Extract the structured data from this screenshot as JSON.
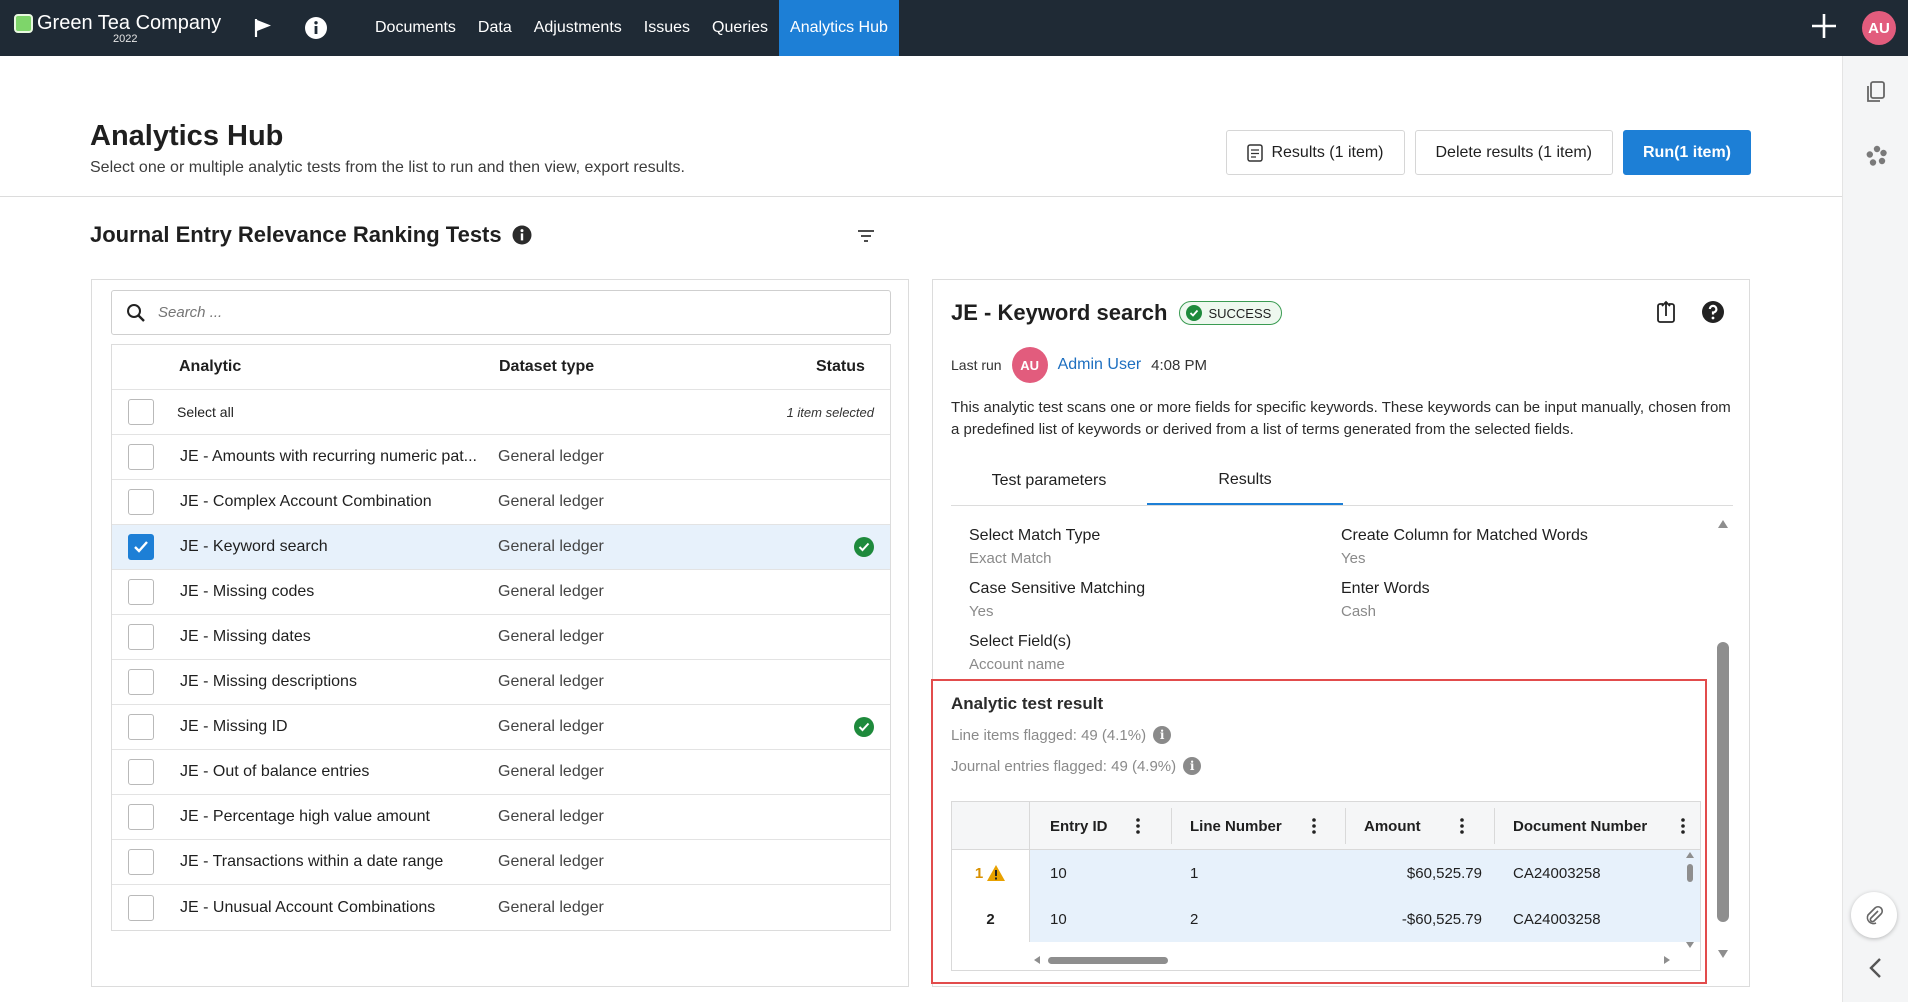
{
  "nav": {
    "brand": "Green Tea Company",
    "year": "2022",
    "links": [
      "Documents",
      "Data",
      "Adjustments",
      "Issues",
      "Queries",
      "Analytics Hub"
    ],
    "active_index": 5,
    "avatar": "AU"
  },
  "header": {
    "title": "Analytics Hub",
    "subtitle": "Select one or multiple analytic tests from the list to run and then view, export results.",
    "results_btn": "Results (1 item)",
    "delete_btn": "Delete results (1 item)",
    "run_btn": "Run(1 item)"
  },
  "section": {
    "title": "Journal Entry Relevance Ranking Tests"
  },
  "list": {
    "search_placeholder": "Search ...",
    "columns": {
      "analytic": "Analytic",
      "dataset": "Dataset type",
      "status": "Status"
    },
    "select_all": "Select all",
    "selected_count": "1 item selected",
    "rows": [
      {
        "name": "JE - Amounts with recurring numeric pat...",
        "dataset": "General ledger",
        "checked": false,
        "status": ""
      },
      {
        "name": "JE - Complex Account Combination",
        "dataset": "General ledger",
        "checked": false,
        "status": ""
      },
      {
        "name": "JE - Keyword search",
        "dataset": "General ledger",
        "checked": true,
        "status": "success"
      },
      {
        "name": "JE - Missing codes",
        "dataset": "General ledger",
        "checked": false,
        "status": ""
      },
      {
        "name": "JE - Missing dates",
        "dataset": "General ledger",
        "checked": false,
        "status": ""
      },
      {
        "name": "JE - Missing descriptions",
        "dataset": "General ledger",
        "checked": false,
        "status": ""
      },
      {
        "name": "JE - Missing ID",
        "dataset": "General ledger",
        "checked": false,
        "status": "success"
      },
      {
        "name": "JE - Out of balance entries",
        "dataset": "General ledger",
        "checked": false,
        "status": ""
      },
      {
        "name": "JE - Percentage high value amount",
        "dataset": "General ledger",
        "checked": false,
        "status": ""
      },
      {
        "name": "JE - Transactions within a date range",
        "dataset": "General ledger",
        "checked": false,
        "status": ""
      },
      {
        "name": "JE - Unusual Account Combinations",
        "dataset": "General ledger",
        "checked": false,
        "status": ""
      }
    ]
  },
  "detail": {
    "title": "JE - Keyword search",
    "badge": "SUCCESS",
    "last_run_label": "Last run",
    "avatar": "AU",
    "user": "Admin User",
    "time": "4:08 PM",
    "description": "This analytic test scans one or more fields for specific keywords. These keywords can be input manually, chosen from a predefined list of keywords or derived from a list of terms generated from the selected fields.",
    "tabs": [
      "Test parameters",
      "Results"
    ],
    "active_tab": 1,
    "params": [
      {
        "label": "Select Match Type",
        "value": "Exact Match"
      },
      {
        "label": "Create Column for Matched Words",
        "value": "Yes"
      },
      {
        "label": "Case Sensitive Matching",
        "value": "Yes"
      },
      {
        "label": "Enter Words",
        "value": "Cash"
      },
      {
        "label": "Select Field(s)",
        "value": "Account name"
      }
    ],
    "result": {
      "title": "Analytic test result",
      "line_items": "Line items flagged: 49 (4.1%)",
      "journal_entries": "Journal entries flagged: 49 (4.9%)",
      "columns": [
        "Entry ID",
        "Line Number",
        "Amount",
        "Document Number"
      ],
      "rows": [
        {
          "num": "1",
          "warn": true,
          "entry_id": "10",
          "line": "1",
          "amount": "$60,525.79",
          "doc": "CA24003258"
        },
        {
          "num": "2",
          "warn": false,
          "entry_id": "10",
          "line": "2",
          "amount": "-$60,525.79",
          "doc": "CA24003258"
        }
      ]
    }
  },
  "colors": {
    "nav_bg": "#1f2a35",
    "accent": "#1d7fd6",
    "success": "#1e8a3c",
    "highlight": "#e24c4c",
    "warning": "#d89000"
  }
}
